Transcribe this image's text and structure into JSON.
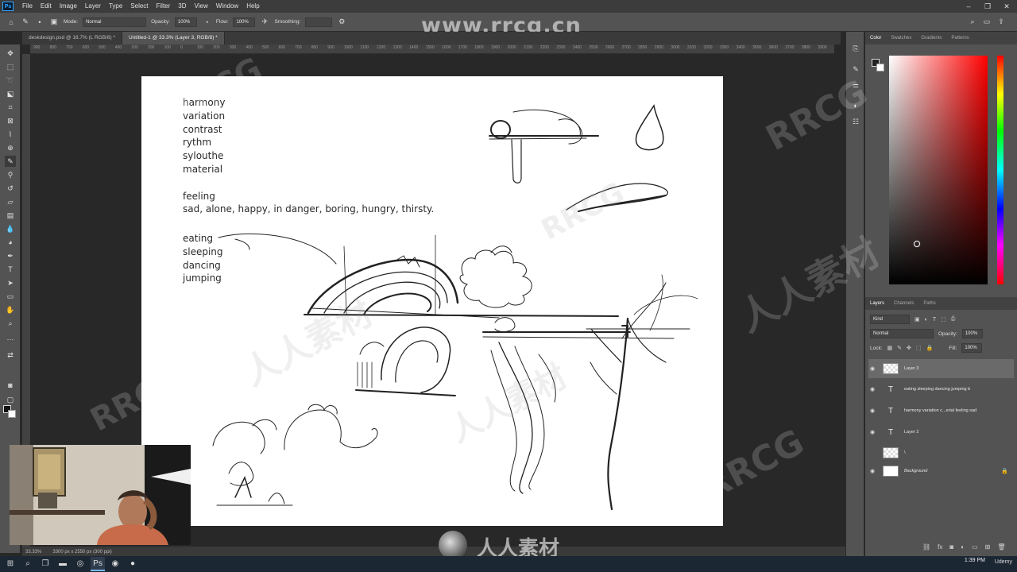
{
  "menu": {
    "logo": "Ps",
    "items": [
      "File",
      "Edit",
      "Image",
      "Layer",
      "Type",
      "Select",
      "Filter",
      "3D",
      "View",
      "Window",
      "Help"
    ]
  },
  "options": {
    "mode_label": "Mode:",
    "mode_value": "Normal",
    "opacity_label": "Opacity:",
    "opacity_value": "100%",
    "flow_label": "Flow:",
    "flow_value": "100%",
    "smoothing_label": "Smoothing:"
  },
  "watermark": {
    "url": "www.rrcg.cn",
    "text_cn": "人人素材",
    "text_en": "RRCG"
  },
  "tabs": [
    {
      "label": "deskdesign.psd @ 16.7% (L RGB/8) *"
    },
    {
      "label": "Untitled-1 @ 33.3% (Layer 3, RGB/8) *"
    }
  ],
  "ruler_ticks": [
    "900",
    "800",
    "700",
    "600",
    "500",
    "400",
    "300",
    "200",
    "100",
    "0",
    "100",
    "200",
    "300",
    "400",
    "500",
    "600",
    "700",
    "800",
    "900",
    "1000",
    "1100",
    "1200",
    "1300",
    "1400",
    "1500",
    "1600",
    "1700",
    "1800",
    "1900",
    "2000",
    "2100",
    "2200",
    "2300",
    "2400",
    "2500",
    "2600",
    "2700",
    "2800",
    "2900",
    "3000",
    "3100",
    "3200",
    "3300",
    "3400",
    "3500",
    "3600",
    "3700",
    "3800",
    "3900"
  ],
  "canvas_notes": {
    "principles": [
      "harmony",
      "variation",
      "contrast",
      "rythm",
      "sylouthe",
      "material"
    ],
    "feeling_title": "feeling",
    "feeling_list": "sad, alone, happy, in danger, boring, hungry, thirsty.",
    "actions": [
      "eating",
      "sleeping",
      "dancing",
      "jumping"
    ]
  },
  "status": {
    "zoom": "33.33%",
    "doc_size": "3300 px x 2550 px (300 ppi)"
  },
  "color_panel": {
    "tabs": [
      "Color",
      "Swatches",
      "Gradients",
      "Patterns"
    ],
    "active_hue": "#ff0000"
  },
  "layers_panel": {
    "tabs": [
      "Layers",
      "Channels",
      "Paths"
    ],
    "kind_label": "Kind",
    "blend_mode": "Normal",
    "opacity_label": "Opacity:",
    "opacity_value": "100%",
    "lock_label": "Lock:",
    "fill_label": "Fill:",
    "fill_value": "100%",
    "layers": [
      {
        "name": "Layer 3",
        "type": "raster",
        "visible": true,
        "selected": true
      },
      {
        "name": "eating sleeping dancing jumping  b",
        "type": "text",
        "visible": true,
        "selected": false
      },
      {
        "name": "harmony variation c...erial  feeling sad",
        "type": "text",
        "visible": true,
        "selected": false
      },
      {
        "name": "Layer 2",
        "type": "text",
        "visible": true,
        "selected": false
      },
      {
        "name": "\\",
        "type": "raster",
        "visible": false,
        "selected": false
      },
      {
        "name": "Background",
        "type": "background",
        "visible": true,
        "selected": false
      }
    ]
  },
  "taskbar": {
    "time": "1:39 PM",
    "brand": "Udemy"
  }
}
